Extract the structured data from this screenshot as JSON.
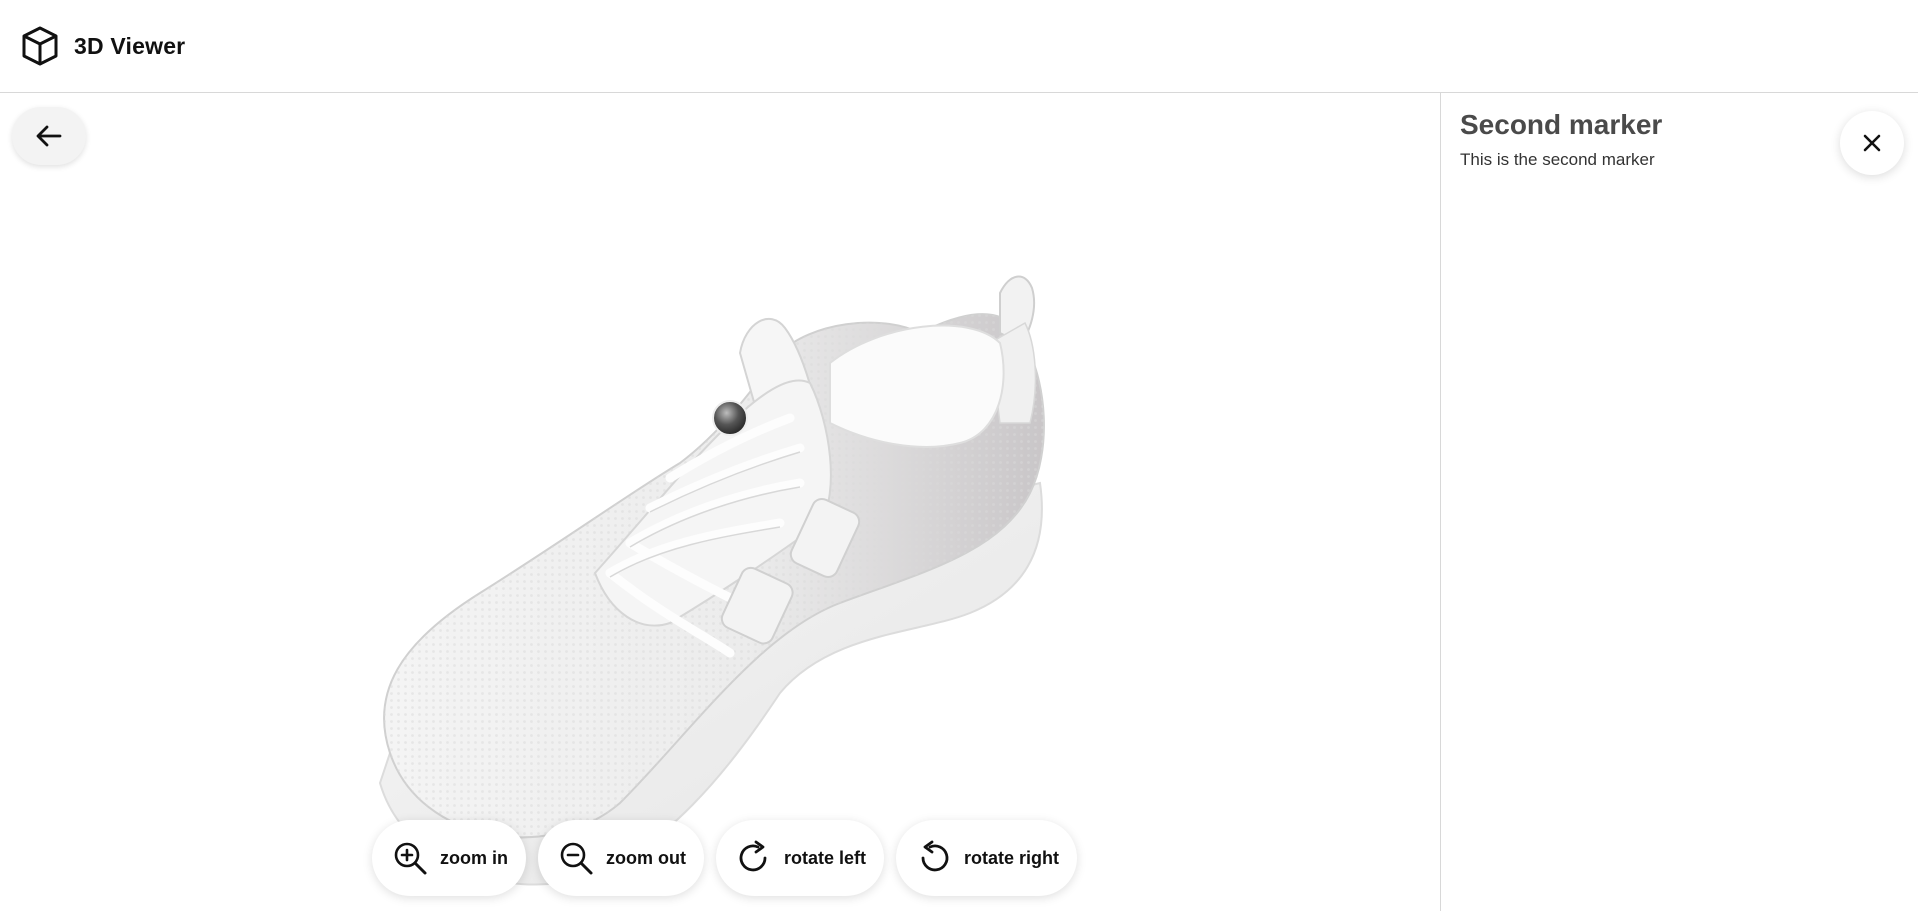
{
  "header": {
    "title": "3D Viewer",
    "logo_icon": "cube-icon"
  },
  "viewer": {
    "back_icon": "arrow-left-icon",
    "model": "sneaker",
    "marker_icon": "marker-dot-icon",
    "controls": [
      {
        "label": "zoom in",
        "icon": "zoom-in-icon"
      },
      {
        "label": "zoom out",
        "icon": "zoom-out-icon"
      },
      {
        "label": "rotate left",
        "icon": "rotate-left-icon"
      },
      {
        "label": "rotate right",
        "icon": "rotate-right-icon"
      }
    ]
  },
  "panel": {
    "title": "Second marker",
    "description": "This is the second marker",
    "close_icon": "close-icon"
  },
  "colors": {
    "border": "#d8d8d8",
    "panel_title": "#4a4a4a",
    "button_bg": "#ffffff",
    "back_button_bg": "#f3f3f3"
  }
}
